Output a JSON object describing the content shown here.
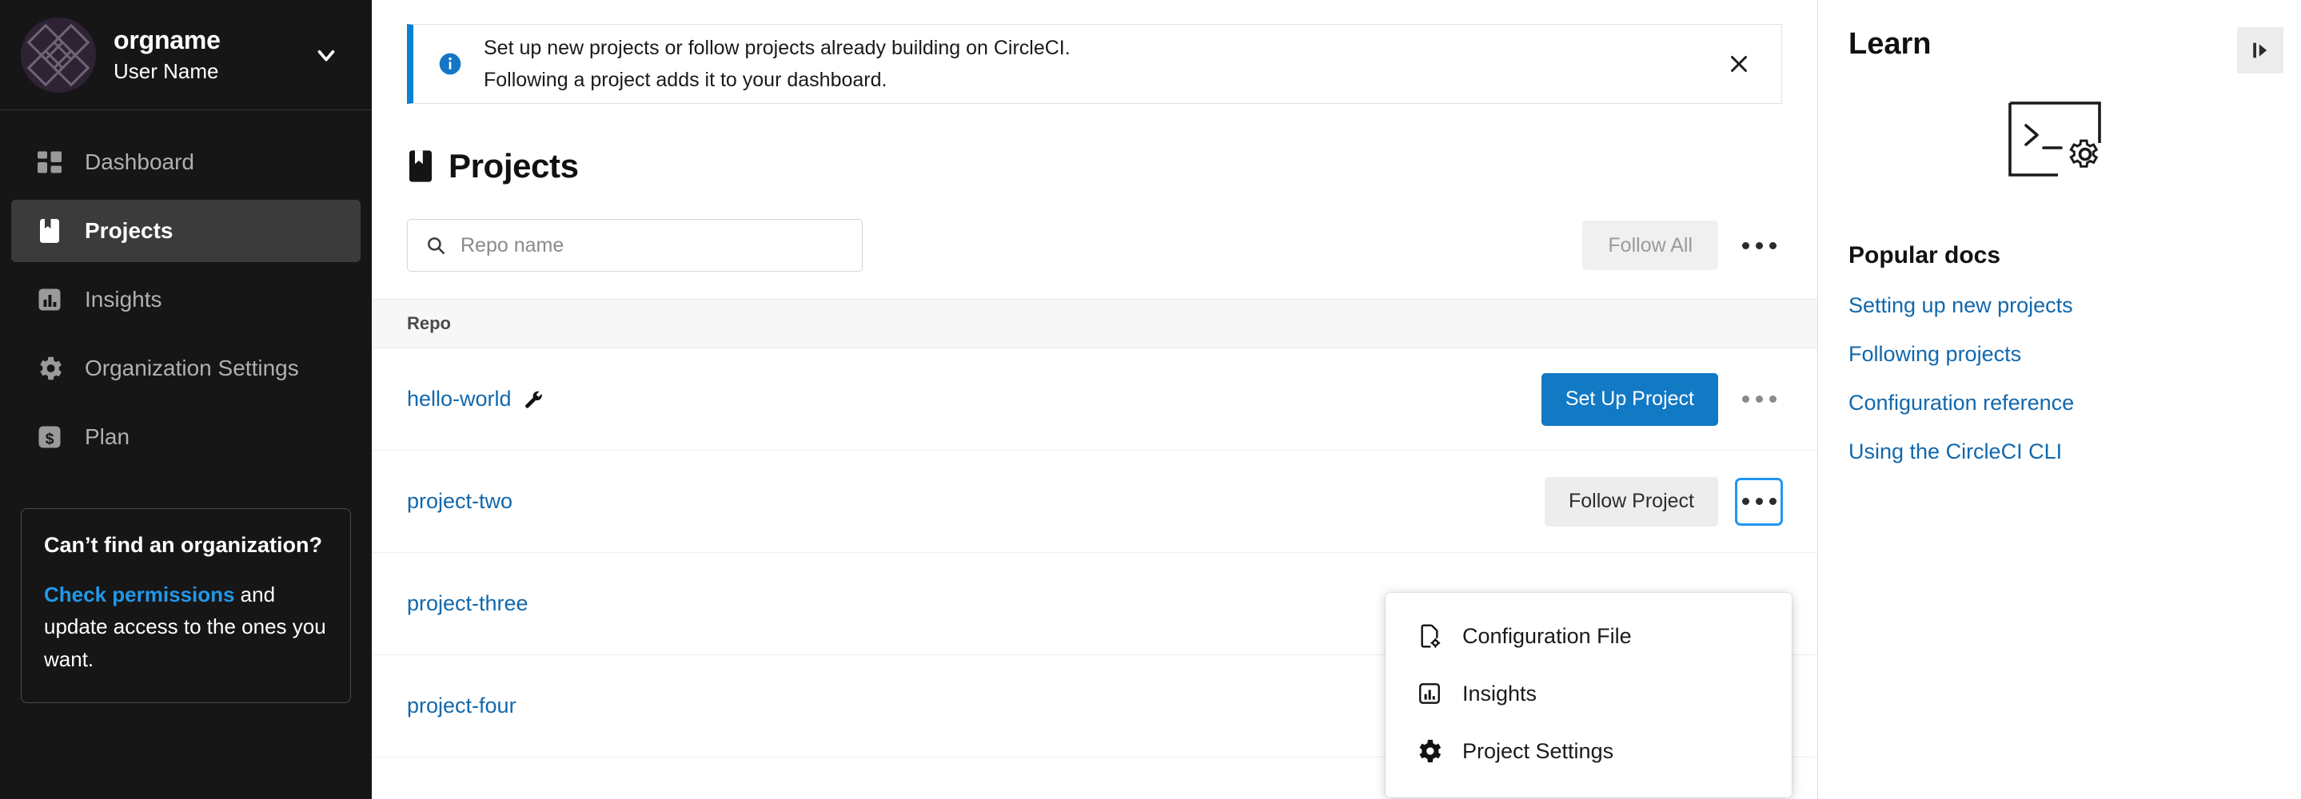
{
  "sidebar": {
    "org": {
      "name": "orgname",
      "user": "User Name",
      "avatar_bg": "#2e2334"
    },
    "nav_items": [
      {
        "label": "Dashboard",
        "icon": "dashboard-icon",
        "active": false
      },
      {
        "label": "Projects",
        "icon": "projects-bookmark-icon",
        "active": true
      },
      {
        "label": "Insights",
        "icon": "insights-bar-chart-icon",
        "active": false
      },
      {
        "label": "Organization Settings",
        "icon": "gear-icon",
        "active": false
      },
      {
        "label": "Plan",
        "icon": "dollar-icon",
        "active": false
      }
    ],
    "permissions_card": {
      "title": "Can’t find an organization?",
      "link": "Check permissions",
      "body_after_link": " and update access to the ones you want."
    }
  },
  "banner": {
    "line1": "Set up new projects or follow projects already building on CircleCI.",
    "line2": "Following a project adds it to your dashboard.",
    "icon": "info-icon",
    "close_icon": "close-icon",
    "accent_color": "#0a7fd4"
  },
  "page": {
    "title": "Projects",
    "title_icon": "projects-bookmark-icon"
  },
  "toolbar": {
    "search_placeholder": "Repo name",
    "search_value": "",
    "search_icon": "search-icon",
    "follow_all_label": "Follow All",
    "kebab_icon": "ellipsis-icon"
  },
  "table": {
    "columns": [
      "Repo"
    ],
    "rows": [
      {
        "name": "hello-world",
        "badge_icon": "wrench-icon",
        "action_label": "Set Up Project",
        "action_kind": "primary"
      },
      {
        "name": "project-two",
        "badge_icon": "",
        "action_label": "Follow Project",
        "action_kind": "secondary"
      },
      {
        "name": "project-three",
        "badge_icon": "",
        "action_label": "",
        "action_kind": "hidden"
      },
      {
        "name": "project-four",
        "badge_icon": "",
        "action_label": "",
        "action_kind": "hidden"
      }
    ]
  },
  "dropdown": {
    "items": [
      {
        "label": "Configuration File",
        "icon": "config-file-icon"
      },
      {
        "label": "Insights",
        "icon": "insights-bar-chart-icon"
      },
      {
        "label": "Project Settings",
        "icon": "gear-icon"
      }
    ]
  },
  "right_panel": {
    "title": "Learn",
    "collapse_icon": "panel-collapse-right-icon",
    "art_icon": "terminal-gear-icon",
    "popular_docs_title": "Popular docs",
    "links": [
      "Setting up new projects",
      "Following projects",
      "Configuration reference",
      "Using the CircleCI CLI"
    ],
    "link_color": "#1168ad"
  }
}
